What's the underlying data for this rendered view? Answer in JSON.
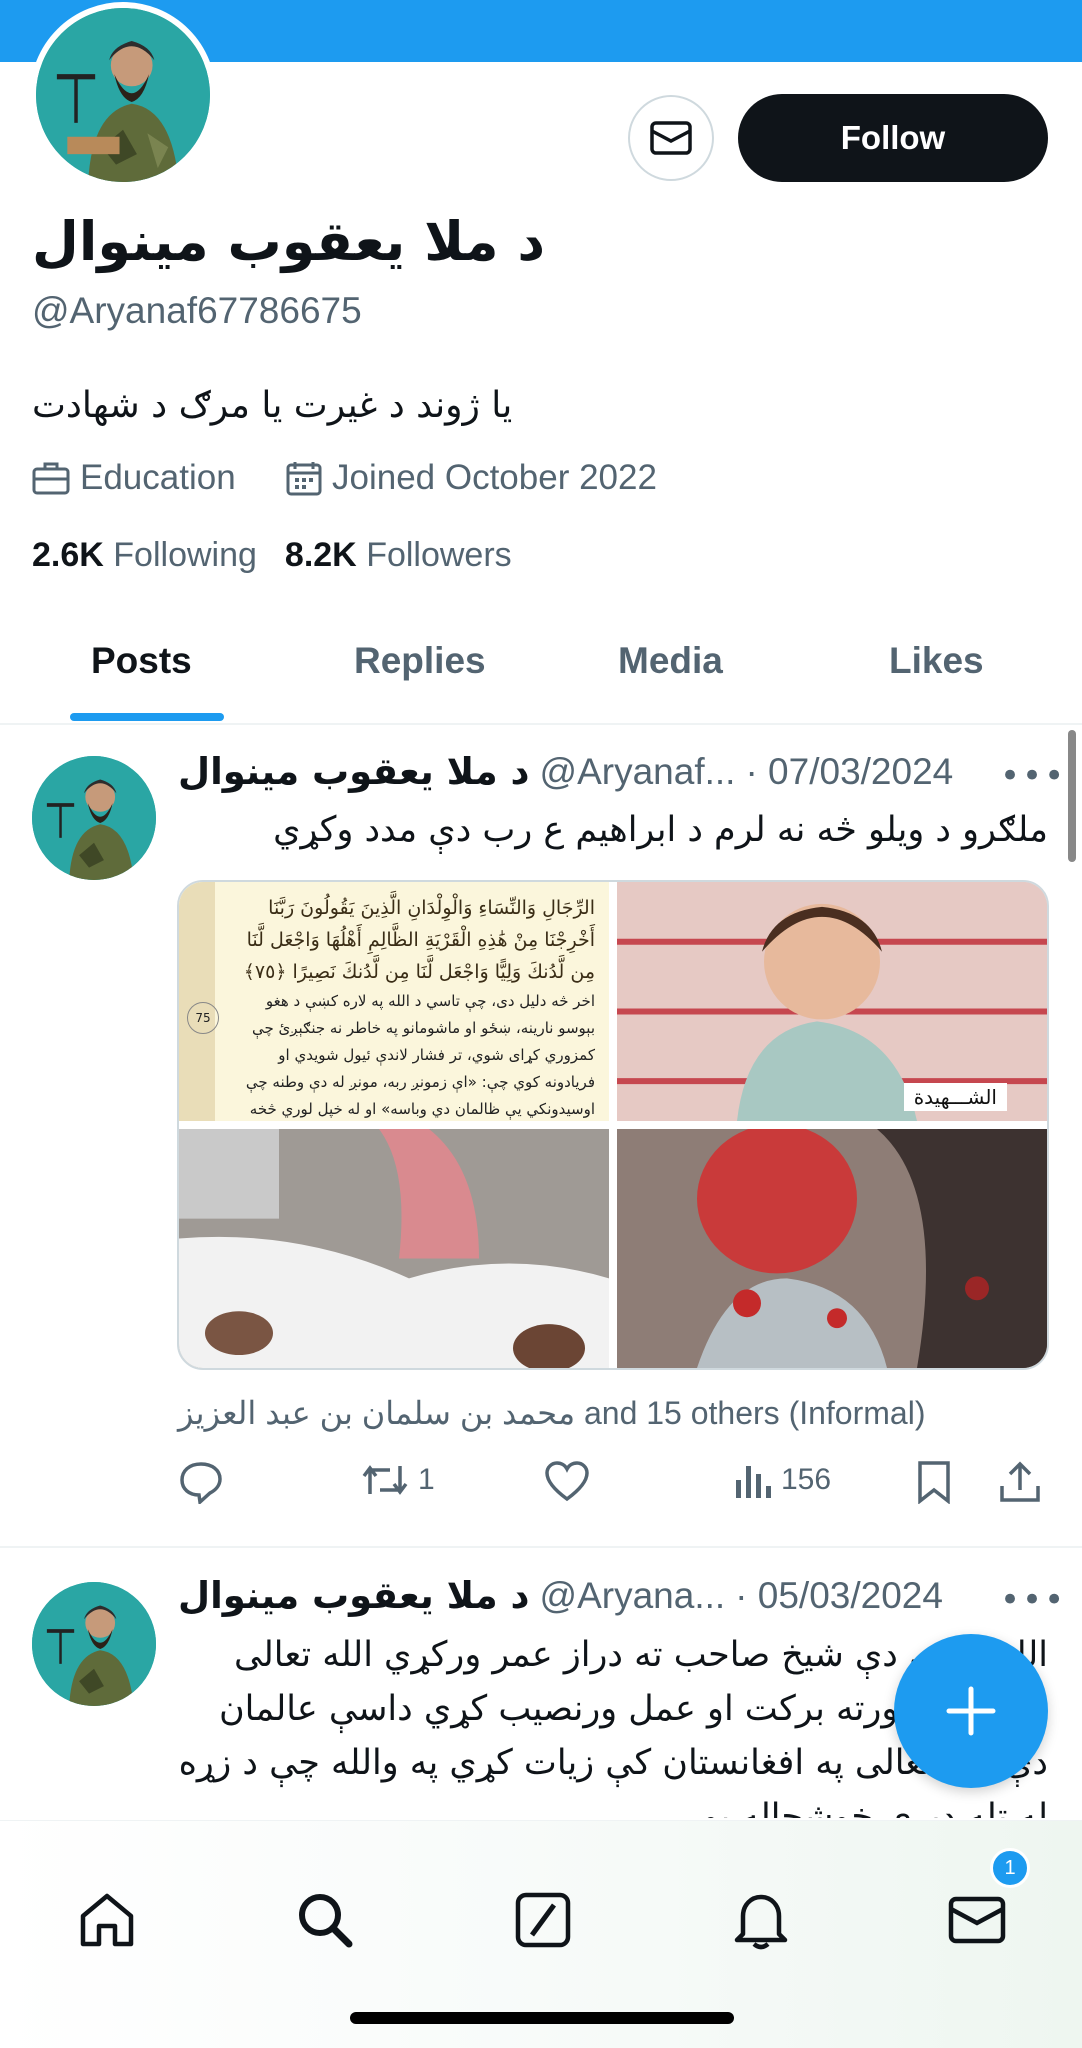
{
  "profile": {
    "display_name": "د ملا یعقوب مینوال",
    "handle": "@Aryanaf67786675",
    "bio": "یا ژوند د غیرت یا مرګ د شهادت",
    "category": "Education",
    "joined": "Joined October 2022",
    "following_count": "2.6K",
    "following_label": "Following",
    "followers_count": "8.2K",
    "followers_label": "Followers",
    "follow_label": "Follow"
  },
  "icons": {
    "dm": "mail-icon",
    "category": "briefcase-icon",
    "joined": "calendar-icon",
    "more": "more-icon",
    "reply": "reply-icon",
    "repost": "repost-icon",
    "like": "heart-icon",
    "views": "views-icon",
    "bookmark": "bookmark-icon",
    "share": "share-icon",
    "compose": "plus-icon"
  },
  "tabs": [
    {
      "label": "Posts",
      "active": true
    },
    {
      "label": "Replies",
      "active": false
    },
    {
      "label": "Media",
      "active": false
    },
    {
      "label": "Likes",
      "active": false
    }
  ],
  "posts": [
    {
      "name": "د ملا یعقوب مینوال",
      "handle": "@Aryanaf...",
      "date": "· 07/03/2024",
      "text": "ملګرو د ویلو څه نه لرم د ابراهیم ع رب دې مدد وکړي",
      "media": {
        "quran_ayah": "الرِّجَالِ وَالنِّسَاءِ وَالْوِلْدَانِ الَّذِينَ يَقُولُونَ رَبَّنَا أَخْرِجْنَا مِنْ هَٰذِهِ الْقَرْيَةِ الظَّالِمِ أَهْلُهَا وَاجْعَل لَّنَا مِن لَّدُنكَ وَلِيًّا وَاجْعَل لَّنَا مِن لَّدُنكَ نَصِيرًا ﴿٧٥﴾",
        "quran_translation": "اخر څه دلیل دی، چې تاسي د الله په لاره کښې د هغو بېوسو نارینه، ښځو او ماشومانو په خاطر نه جنګېږئ چې کمزوري کړای شوي، تر فشار لاندې ئيول شويدي او فريادونه کوي چې: «اې زمونږ ربه، مونږ له دې وطنه چې اوسيدونکي يې ظالمان دي وباسه» او له خپل لوري څخه",
        "page_number": "75",
        "tile_label": "الشـــهيدة"
      },
      "mentions": "محمد بن سلمان بن عبد العزيز and 15 others (Informal)",
      "reposts": "1",
      "views": "156"
    },
    {
      "name": "د ملا یعقوب مینوال",
      "handle": "@Aryana...",
      "date": "· 05/03/2024",
      "text": "الله تعالی دې شیخ صاحب ته دراز عمر ورکړي الله تعالی اسلام کې ورته برکت او عمل ورنصیب کړي داسې عالمان دې الله تعالی په افغانستان کې زیات کړي په والله چې د زړه له تله ډیرې خوشحاله یو"
    }
  ],
  "nav": {
    "home": "home-icon",
    "search": "search-icon",
    "grok": "grok-icon",
    "notifications": "bell-icon",
    "messages": "mail-icon",
    "messages_badge": "1"
  },
  "colors": {
    "accent": "#1d9bf0",
    "text": "#0f1419",
    "secondary": "#536471",
    "border": "#cfd9de"
  }
}
